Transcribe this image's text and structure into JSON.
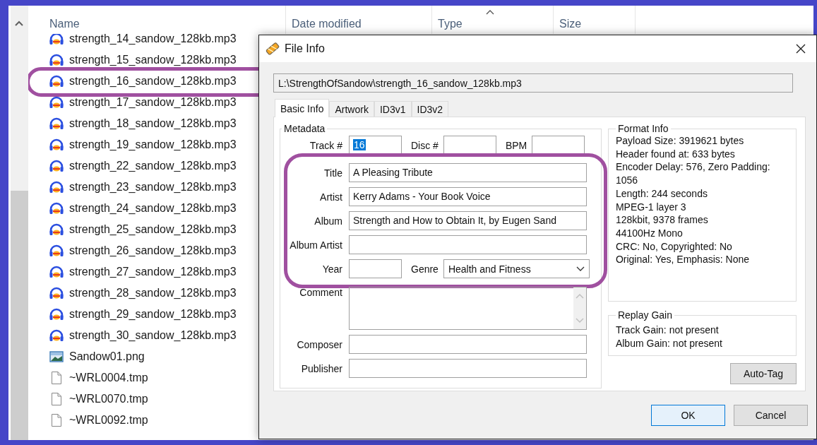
{
  "explorer": {
    "columns": [
      {
        "label": "Name",
        "sorted": false
      },
      {
        "label": "Date modified",
        "sorted": false
      },
      {
        "label": "Type",
        "sorted": true
      },
      {
        "label": "Size",
        "sorted": false
      }
    ],
    "files": [
      {
        "name": "strength_14_sandow_128kb.mp3",
        "kind": "audio",
        "annotated": false
      },
      {
        "name": "strength_15_sandow_128kb.mp3",
        "kind": "audio",
        "annotated": false
      },
      {
        "name": "strength_16_sandow_128kb.mp3",
        "kind": "audio",
        "annotated": true
      },
      {
        "name": "strength_17_sandow_128kb.mp3",
        "kind": "audio",
        "annotated": false
      },
      {
        "name": "strength_18_sandow_128kb.mp3",
        "kind": "audio",
        "annotated": false
      },
      {
        "name": "strength_19_sandow_128kb.mp3",
        "kind": "audio",
        "annotated": false
      },
      {
        "name": "strength_22_sandow_128kb.mp3",
        "kind": "audio",
        "annotated": false
      },
      {
        "name": "strength_23_sandow_128kb.mp3",
        "kind": "audio",
        "annotated": false
      },
      {
        "name": "strength_24_sandow_128kb.mp3",
        "kind": "audio",
        "annotated": false
      },
      {
        "name": "strength_25_sandow_128kb.mp3",
        "kind": "audio",
        "annotated": false
      },
      {
        "name": "strength_26_sandow_128kb.mp3",
        "kind": "audio",
        "annotated": false
      },
      {
        "name": "strength_27_sandow_128kb.mp3",
        "kind": "audio",
        "annotated": false
      },
      {
        "name": "strength_28_sandow_128kb.mp3",
        "kind": "audio",
        "annotated": false
      },
      {
        "name": "strength_29_sandow_128kb.mp3",
        "kind": "audio",
        "annotated": false
      },
      {
        "name": "strength_30_sandow_128kb.mp3",
        "kind": "audio",
        "annotated": false
      },
      {
        "name": "Sandow01.png",
        "kind": "image",
        "annotated": false
      },
      {
        "name": "~WRL0004.tmp",
        "kind": "file",
        "annotated": false
      },
      {
        "name": "~WRL0070.tmp",
        "kind": "file",
        "annotated": false
      },
      {
        "name": "~WRL0092.tmp",
        "kind": "file",
        "annotated": false
      }
    ]
  },
  "dialog": {
    "title": "File Info",
    "path": "L:\\StrengthOfSandow\\strength_16_sandow_128kb.mp3",
    "tabs": [
      {
        "label": "Basic Info",
        "selected": true
      },
      {
        "label": "Artwork",
        "selected": false
      },
      {
        "label": "ID3v1",
        "selected": false
      },
      {
        "label": "ID3v2",
        "selected": false
      }
    ],
    "metadata": {
      "title": "Metadata",
      "groups": [
        {
          "annotated": false,
          "rows": [
            {
              "cells": [
                {
                  "kind": "label",
                  "text": "Track #"
                },
                {
                  "kind": "short_field",
                  "value": "16",
                  "text_selected": true
                },
                {
                  "kind": "label",
                  "text": "Disc #"
                },
                {
                  "kind": "short_field"
                },
                {
                  "kind": "label",
                  "text": "BPM"
                },
                {
                  "kind": "short_field"
                }
              ]
            }
          ]
        },
        {
          "annotated": true,
          "rows": [
            {
              "cells": [
                {
                  "kind": "label",
                  "text": "Title"
                },
                {
                  "kind": "field",
                  "value": "A Pleasing Tribute",
                  "text_selected": false
                }
              ]
            },
            {
              "cells": [
                {
                  "kind": "label",
                  "text": "Artist"
                },
                {
                  "kind": "field",
                  "value": "Kerry Adams - Your Book Voice",
                  "text_selected": false
                }
              ]
            },
            {
              "cells": [
                {
                  "kind": "label",
                  "text": "Album"
                },
                {
                  "kind": "field",
                  "value": "Strength and How to Obtain It, by Eugen Sand",
                  "text_selected": false
                }
              ]
            },
            {
              "cells": [
                {
                  "kind": "label",
                  "text": "Album Artist"
                },
                {
                  "kind": "field"
                }
              ]
            },
            {
              "cells": [
                {
                  "kind": "label",
                  "text": "Year"
                },
                {
                  "kind": "short_field"
                },
                {
                  "kind": "label",
                  "text": "Genre"
                },
                {
                  "kind": "combo",
                  "value": "Health and Fitness"
                }
              ]
            }
          ]
        },
        {
          "annotated": false,
          "rows": [
            {
              "cells": [
                {
                  "kind": "label",
                  "text": "Comment"
                },
                {
                  "kind": "textarea"
                }
              ]
            },
            {
              "cells": [
                {
                  "kind": "label",
                  "text": "Composer"
                },
                {
                  "kind": "field"
                }
              ]
            },
            {
              "cells": [
                {
                  "kind": "label",
                  "text": "Publisher"
                },
                {
                  "kind": "field"
                }
              ]
            }
          ]
        }
      ]
    },
    "format_info": {
      "title": "Format Info",
      "lines": [
        "Payload Size: 3919621 bytes",
        "Header found at: 633 bytes",
        "Encoder Delay: 576, Zero Padding:",
        "1056",
        "Length: 244 seconds",
        "MPEG-1 layer 3",
        "128kbit, 9378 frames",
        "44100Hz Mono",
        "CRC: No, Copyrighted: No",
        "Original: Yes, Emphasis: None"
      ]
    },
    "replay_gain": {
      "title": "Replay Gain",
      "lines": [
        "Track Gain: not present",
        "Album Gain: not present"
      ]
    },
    "auto_tag": "Auto-Tag",
    "buttons": [
      {
        "label": "OK",
        "default": true
      },
      {
        "label": "Cancel",
        "default": false
      }
    ]
  }
}
